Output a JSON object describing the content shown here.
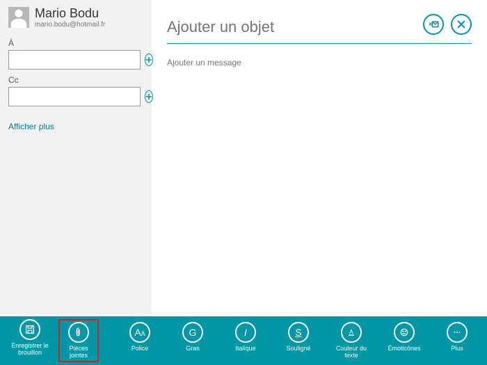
{
  "accent_color": "#0097a7",
  "sender": {
    "name": "Mario Bodu",
    "email": "mario.bodu@hotmail.fr"
  },
  "fields": {
    "to_label": "À",
    "to_value": "",
    "cc_label": "Cc",
    "cc_value": "",
    "show_more": "Afficher plus"
  },
  "compose": {
    "subject_placeholder": "Ajouter un objet",
    "body_placeholder": "Ajouter un message"
  },
  "appbar": {
    "save_draft": "Enregistrer le brouillon",
    "attachments": "Pièces jointes",
    "font": "Police",
    "bold": "Gras",
    "italic": "Italique",
    "underline": "Souligné",
    "text_color": "Couleur du texte",
    "emoticons": "Émoticônes",
    "more": "Plus"
  }
}
